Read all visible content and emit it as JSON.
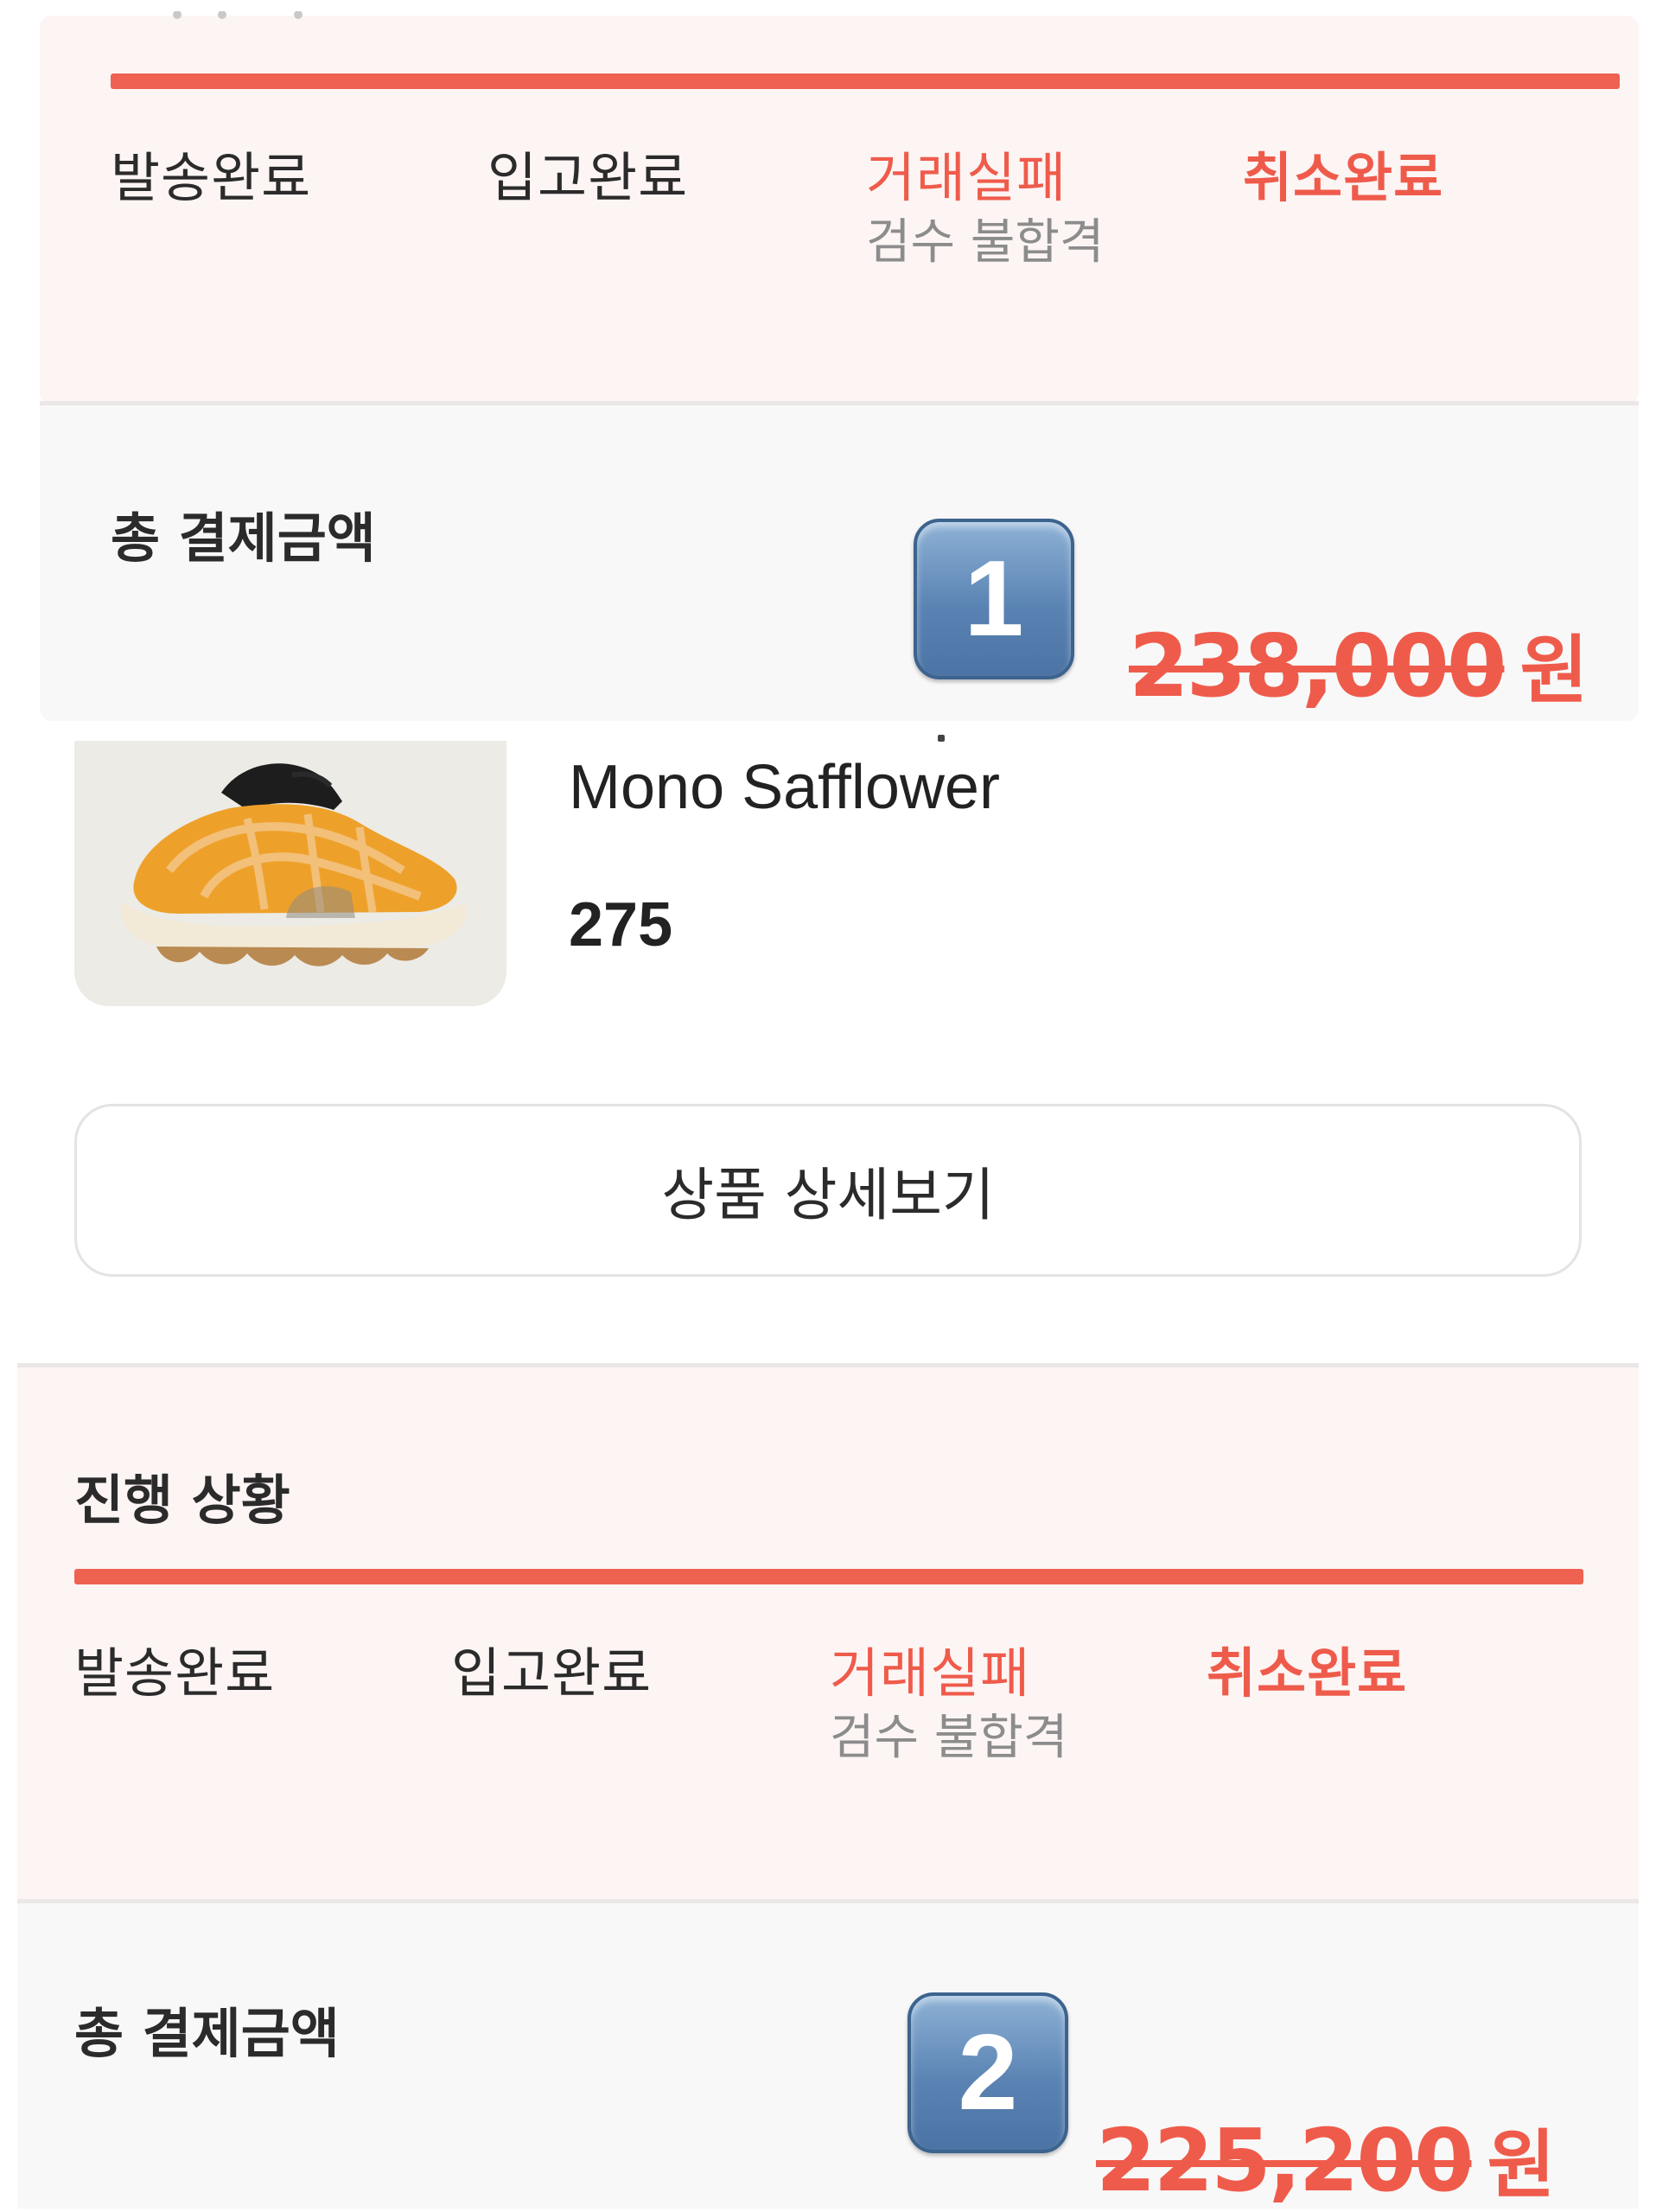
{
  "order1": {
    "steps": [
      {
        "label": "발송완료"
      },
      {
        "label": "입고완료"
      },
      {
        "label": "거래실패",
        "sub": "검수 불합격"
      },
      {
        "label": "취소완료"
      }
    ],
    "total_label": "총 결제금액",
    "badge": "1",
    "price": "238,000",
    "currency": "원"
  },
  "product": {
    "name": "Mono Safflower",
    "size": "275",
    "detail_button": "상품 상세보기"
  },
  "order2": {
    "progress_title": "진행 상황",
    "steps": [
      {
        "label": "발송완료"
      },
      {
        "label": "입고완료"
      },
      {
        "label": "거래실패",
        "sub": "검수 불합격"
      },
      {
        "label": "취소완료"
      }
    ],
    "total_label": "총 결제금액",
    "badge": "2",
    "price": "225,200",
    "currency": "원"
  },
  "colors": {
    "accent": "#ef5b4b",
    "panel_pink": "#fcf5f4",
    "panel_gray": "#f8f8f8"
  },
  "icons": [
    "keycap-1-icon",
    "keycap-2-icon",
    "sneaker-product-image"
  ]
}
